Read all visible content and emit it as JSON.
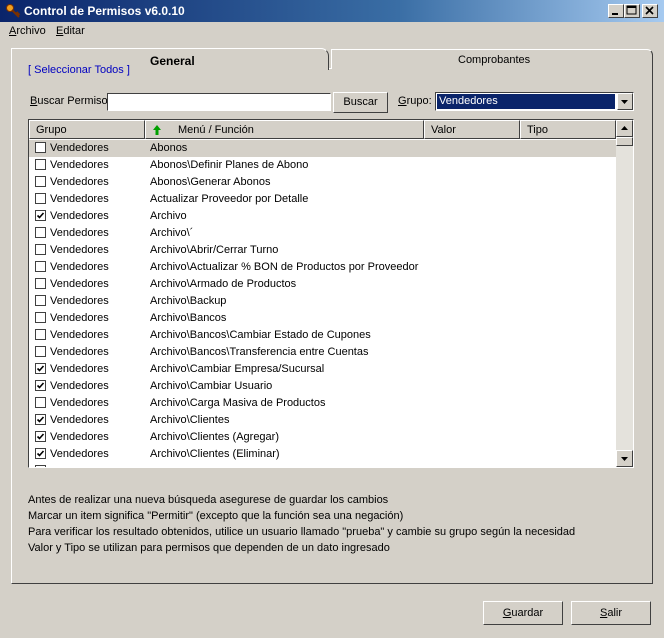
{
  "window": {
    "title": "Control de Permisos v6.0.10",
    "controls": [
      "minimize",
      "maximize",
      "close"
    ]
  },
  "menu": [
    {
      "label": "Archivo"
    },
    {
      "label": "Editar"
    }
  ],
  "tabs": [
    {
      "label": "General",
      "active": true
    },
    {
      "label": "Comprobantes",
      "active": false
    }
  ],
  "select_all_link": "[ Seleccionar Todos ]",
  "search": {
    "label": "Buscar Permiso:",
    "value": "",
    "button_label": "Buscar"
  },
  "grupo": {
    "label": "Grupo:",
    "selected": "Vendedores"
  },
  "table": {
    "columns": [
      "Grupo",
      "Menú / Función",
      "Valor",
      "Tipo"
    ],
    "sort_column": "Menú / Función",
    "rows": [
      {
        "grupo": "Vendedores",
        "menu": "Abonos",
        "checked": false,
        "selected": true
      },
      {
        "grupo": "Vendedores",
        "menu": "Abonos\\Definir Planes de Abono",
        "checked": false
      },
      {
        "grupo": "Vendedores",
        "menu": "Abonos\\Generar Abonos",
        "checked": false
      },
      {
        "grupo": "Vendedores",
        "menu": "Actualizar Proveedor por Detalle",
        "checked": false
      },
      {
        "grupo": "Vendedores",
        "menu": "Archivo",
        "checked": true
      },
      {
        "grupo": "Vendedores",
        "menu": "Archivo\\´",
        "checked": false
      },
      {
        "grupo": "Vendedores",
        "menu": "Archivo\\Abrir/Cerrar Turno",
        "checked": false
      },
      {
        "grupo": "Vendedores",
        "menu": "Archivo\\Actualizar % BON de Productos por Proveedor",
        "checked": false
      },
      {
        "grupo": "Vendedores",
        "menu": "Archivo\\Armado de Productos",
        "checked": false
      },
      {
        "grupo": "Vendedores",
        "menu": "Archivo\\Backup",
        "checked": false
      },
      {
        "grupo": "Vendedores",
        "menu": "Archivo\\Bancos",
        "checked": false
      },
      {
        "grupo": "Vendedores",
        "menu": "Archivo\\Bancos\\Cambiar Estado de Cupones",
        "checked": false
      },
      {
        "grupo": "Vendedores",
        "menu": "Archivo\\Bancos\\Transferencia entre Cuentas",
        "checked": false
      },
      {
        "grupo": "Vendedores",
        "menu": "Archivo\\Cambiar Empresa/Sucursal",
        "checked": true
      },
      {
        "grupo": "Vendedores",
        "menu": "Archivo\\Cambiar Usuario",
        "checked": true
      },
      {
        "grupo": "Vendedores",
        "menu": "Archivo\\Carga Masiva de Productos",
        "checked": false
      },
      {
        "grupo": "Vendedores",
        "menu": "Archivo\\Clientes",
        "checked": true
      },
      {
        "grupo": "Vendedores",
        "menu": "Archivo\\Clientes (Agregar)",
        "checked": true
      },
      {
        "grupo": "Vendedores",
        "menu": "Archivo\\Clientes (Eliminar)",
        "checked": true
      }
    ]
  },
  "notes": [
    "Antes de realizar una nueva búsqueda asegurese de guardar los cambios",
    "Marcar un item significa \"Permitir\" (excepto que la función sea una negación)",
    "Para verificar los resultado obtenidos, utilice un usuario llamado \"prueba\" y cambie su grupo según la necesidad",
    "Valor y Tipo se utilizan para permisos que dependen de un dato ingresado"
  ],
  "buttons": {
    "save": "Guardar",
    "exit": "Salir"
  },
  "icons": {
    "app": "key-icon",
    "sort": "sort-up-arrow-icon",
    "check": "checkmark-icon"
  },
  "colors": {
    "titlebar_start": "#0a246a",
    "titlebar_end": "#a6caf0",
    "selection": "#0a246a",
    "link": "#0000c0",
    "sort_arrow": "#00a000"
  }
}
